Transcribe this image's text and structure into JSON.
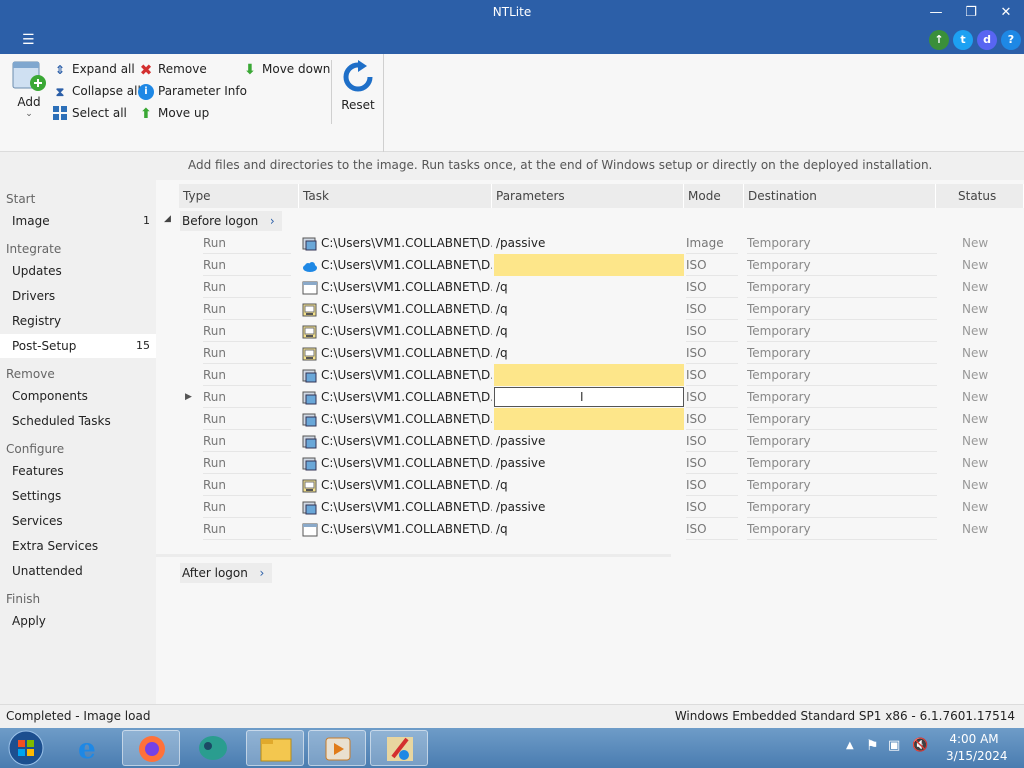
{
  "window": {
    "title": "NTLite"
  },
  "toolbar": {
    "add": "Add",
    "expand_all": "Expand all",
    "collapse_all": "Collapse all",
    "select_all": "Select all",
    "remove": "Remove",
    "parameter_info": "Parameter Info",
    "move_up": "Move up",
    "move_down": "Move down",
    "reset": "Reset"
  },
  "info_text": "Add files and directories to the image. Run tasks once, at the end of Windows setup or directly on the deployed installation.",
  "sidebar": {
    "start": "Start",
    "image": "Image",
    "image_count": "1",
    "integrate": "Integrate",
    "updates": "Updates",
    "drivers": "Drivers",
    "registry": "Registry",
    "post_setup": "Post-Setup",
    "post_setup_count": "15",
    "remove": "Remove",
    "components": "Components",
    "scheduled_tasks": "Scheduled Tasks",
    "configure": "Configure",
    "features": "Features",
    "settings": "Settings",
    "services": "Services",
    "extra_services": "Extra Services",
    "unattended": "Unattended",
    "finish": "Finish",
    "apply": "Apply"
  },
  "table": {
    "columns": {
      "type": "Type",
      "task": "Task",
      "parameters": "Parameters",
      "mode": "Mode",
      "destination": "Destination",
      "status": "Status"
    },
    "group_before": "Before logon",
    "group_after": "After logon",
    "rows": [
      {
        "type": "Run",
        "task": "C:\\Users\\VM1.COLLABNET\\D...",
        "icon": "installer",
        "param": "/passive",
        "mode": "Image",
        "dest": "Temporary",
        "status": "New"
      },
      {
        "type": "Run",
        "task": "C:\\Users\\VM1.COLLABNET\\D...",
        "icon": "cloud",
        "param": "",
        "mode": "ISO",
        "dest": "Temporary",
        "status": "New",
        "highlight": true
      },
      {
        "type": "Run",
        "task": "C:\\Users\\VM1.COLLABNET\\D...",
        "icon": "window",
        "param": "/q",
        "mode": "ISO",
        "dest": "Temporary",
        "status": "New"
      },
      {
        "type": "Run",
        "task": "C:\\Users\\VM1.COLLABNET\\D...",
        "icon": "setup",
        "param": "/q",
        "mode": "ISO",
        "dest": "Temporary",
        "status": "New"
      },
      {
        "type": "Run",
        "task": "C:\\Users\\VM1.COLLABNET\\D...",
        "icon": "setup",
        "param": "/q",
        "mode": "ISO",
        "dest": "Temporary",
        "status": "New"
      },
      {
        "type": "Run",
        "task": "C:\\Users\\VM1.COLLABNET\\D...",
        "icon": "setup",
        "param": "/q",
        "mode": "ISO",
        "dest": "Temporary",
        "status": "New"
      },
      {
        "type": "Run",
        "task": "C:\\Users\\VM1.COLLABNET\\D...",
        "icon": "installer",
        "param": "",
        "mode": "ISO",
        "dest": "Temporary",
        "status": "New",
        "highlight": true
      },
      {
        "type": "Run",
        "task": "C:\\Users\\VM1.COLLABNET\\D...",
        "icon": "installer",
        "param": "",
        "mode": "ISO",
        "dest": "Temporary",
        "status": "New",
        "editing": true,
        "expander": true
      },
      {
        "type": "Run",
        "task": "C:\\Users\\VM1.COLLABNET\\D...",
        "icon": "installer",
        "param": "",
        "mode": "ISO",
        "dest": "Temporary",
        "status": "New",
        "highlight": true
      },
      {
        "type": "Run",
        "task": "C:\\Users\\VM1.COLLABNET\\D...",
        "icon": "installer",
        "param": "/passive",
        "mode": "ISO",
        "dest": "Temporary",
        "status": "New"
      },
      {
        "type": "Run",
        "task": "C:\\Users\\VM1.COLLABNET\\D...",
        "icon": "installer",
        "param": "/passive",
        "mode": "ISO",
        "dest": "Temporary",
        "status": "New"
      },
      {
        "type": "Run",
        "task": "C:\\Users\\VM1.COLLABNET\\D...",
        "icon": "setup",
        "param": "/q",
        "mode": "ISO",
        "dest": "Temporary",
        "status": "New"
      },
      {
        "type": "Run",
        "task": "C:\\Users\\VM1.COLLABNET\\D...",
        "icon": "installer",
        "param": "/passive",
        "mode": "ISO",
        "dest": "Temporary",
        "status": "New"
      },
      {
        "type": "Run",
        "task": "C:\\Users\\VM1.COLLABNET\\D...",
        "icon": "window",
        "param": "/q",
        "mode": "ISO",
        "dest": "Temporary",
        "status": "New"
      }
    ]
  },
  "statusbar": {
    "left": "Completed - Image load",
    "right": "Windows Embedded Standard SP1 x86 - 6.1.7601.17514"
  },
  "taskbar": {
    "time": "4:00 AM",
    "date": "3/15/2024"
  },
  "colors": {
    "title_bar": "#2c5fa8",
    "highlight": "#fde68a",
    "twitter": "#1da1f2",
    "discord": "#5865f2"
  }
}
